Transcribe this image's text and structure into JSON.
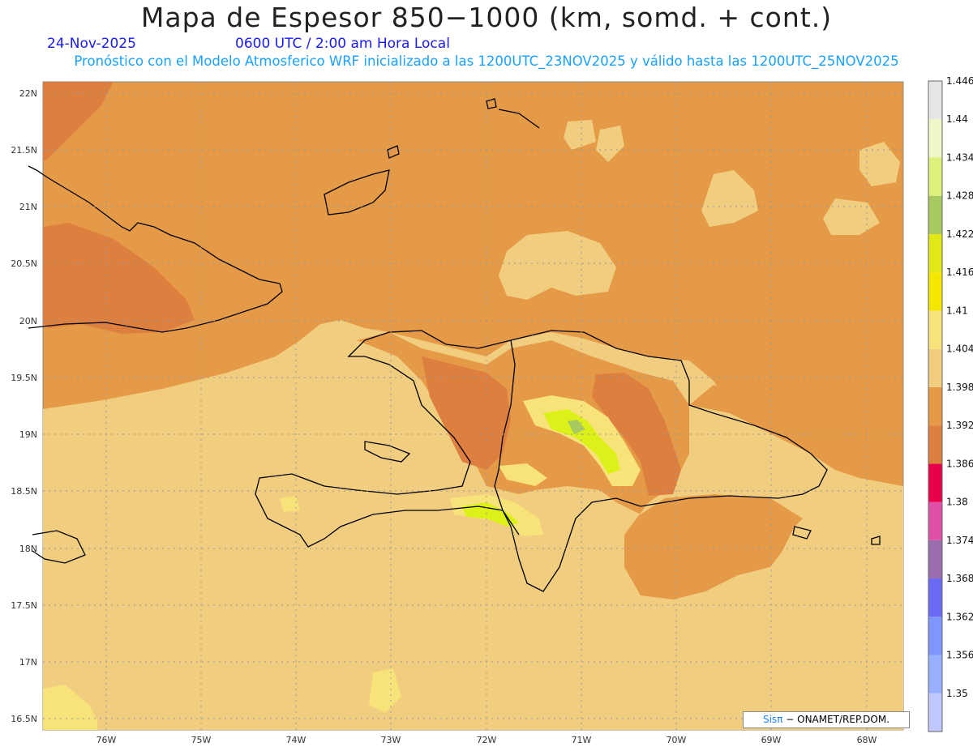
{
  "header": {
    "title": "Mapa de Espesor 850−1000 (km, somd. + cont.)",
    "date": "24-Nov-2025",
    "valid_time": "0600 UTC / 2:00 am Hora Local",
    "forecast_note": "Pronóstico con el Modelo Atmosferico WRF inicializado a las 1200UTC_23NOV2025 y válido hasta las  1200UTC_25NOV2025"
  },
  "axes": {
    "lat_labels": [
      "22N",
      "21.5N",
      "21N",
      "20.5N",
      "20N",
      "19.5N",
      "19N",
      "18.5N",
      "18N",
      "17.5N",
      "17N",
      "16.5N"
    ],
    "lon_labels": [
      "76W",
      "75W",
      "74W",
      "73W",
      "72W",
      "71W",
      "70W",
      "69W",
      "68W"
    ]
  },
  "colorbar": {
    "levels": [
      "1.35",
      "1.356",
      "1.362",
      "1.368",
      "1.374",
      "1.38",
      "1.386",
      "1.392",
      "1.398",
      "1.404",
      "1.41",
      "1.416",
      "1.422",
      "1.428",
      "1.434",
      "1.44",
      "1.446"
    ],
    "colors": [
      "#c0c8ff",
      "#98b0ff",
      "#7f96ff",
      "#6a6af5",
      "#9a6eac",
      "#e050a8",
      "#e8004a",
      "#dd7f3e",
      "#e59a47",
      "#f1cd80",
      "#f8e27a",
      "#f5e600",
      "#e0e818",
      "#a8c860",
      "#dcf07a",
      "#f0f6c8",
      "#e6e6e6"
    ]
  },
  "credit": {
    "brand": "Sisπ",
    "text": "− ONAMET/REP.DOM."
  },
  "colors": {
    "ocean": "#e59a47",
    "land": "#f1cd80",
    "warm_core": "#dd7f3e",
    "peak": "#dcf01a",
    "grid": "#888888",
    "coast": "#000000"
  }
}
